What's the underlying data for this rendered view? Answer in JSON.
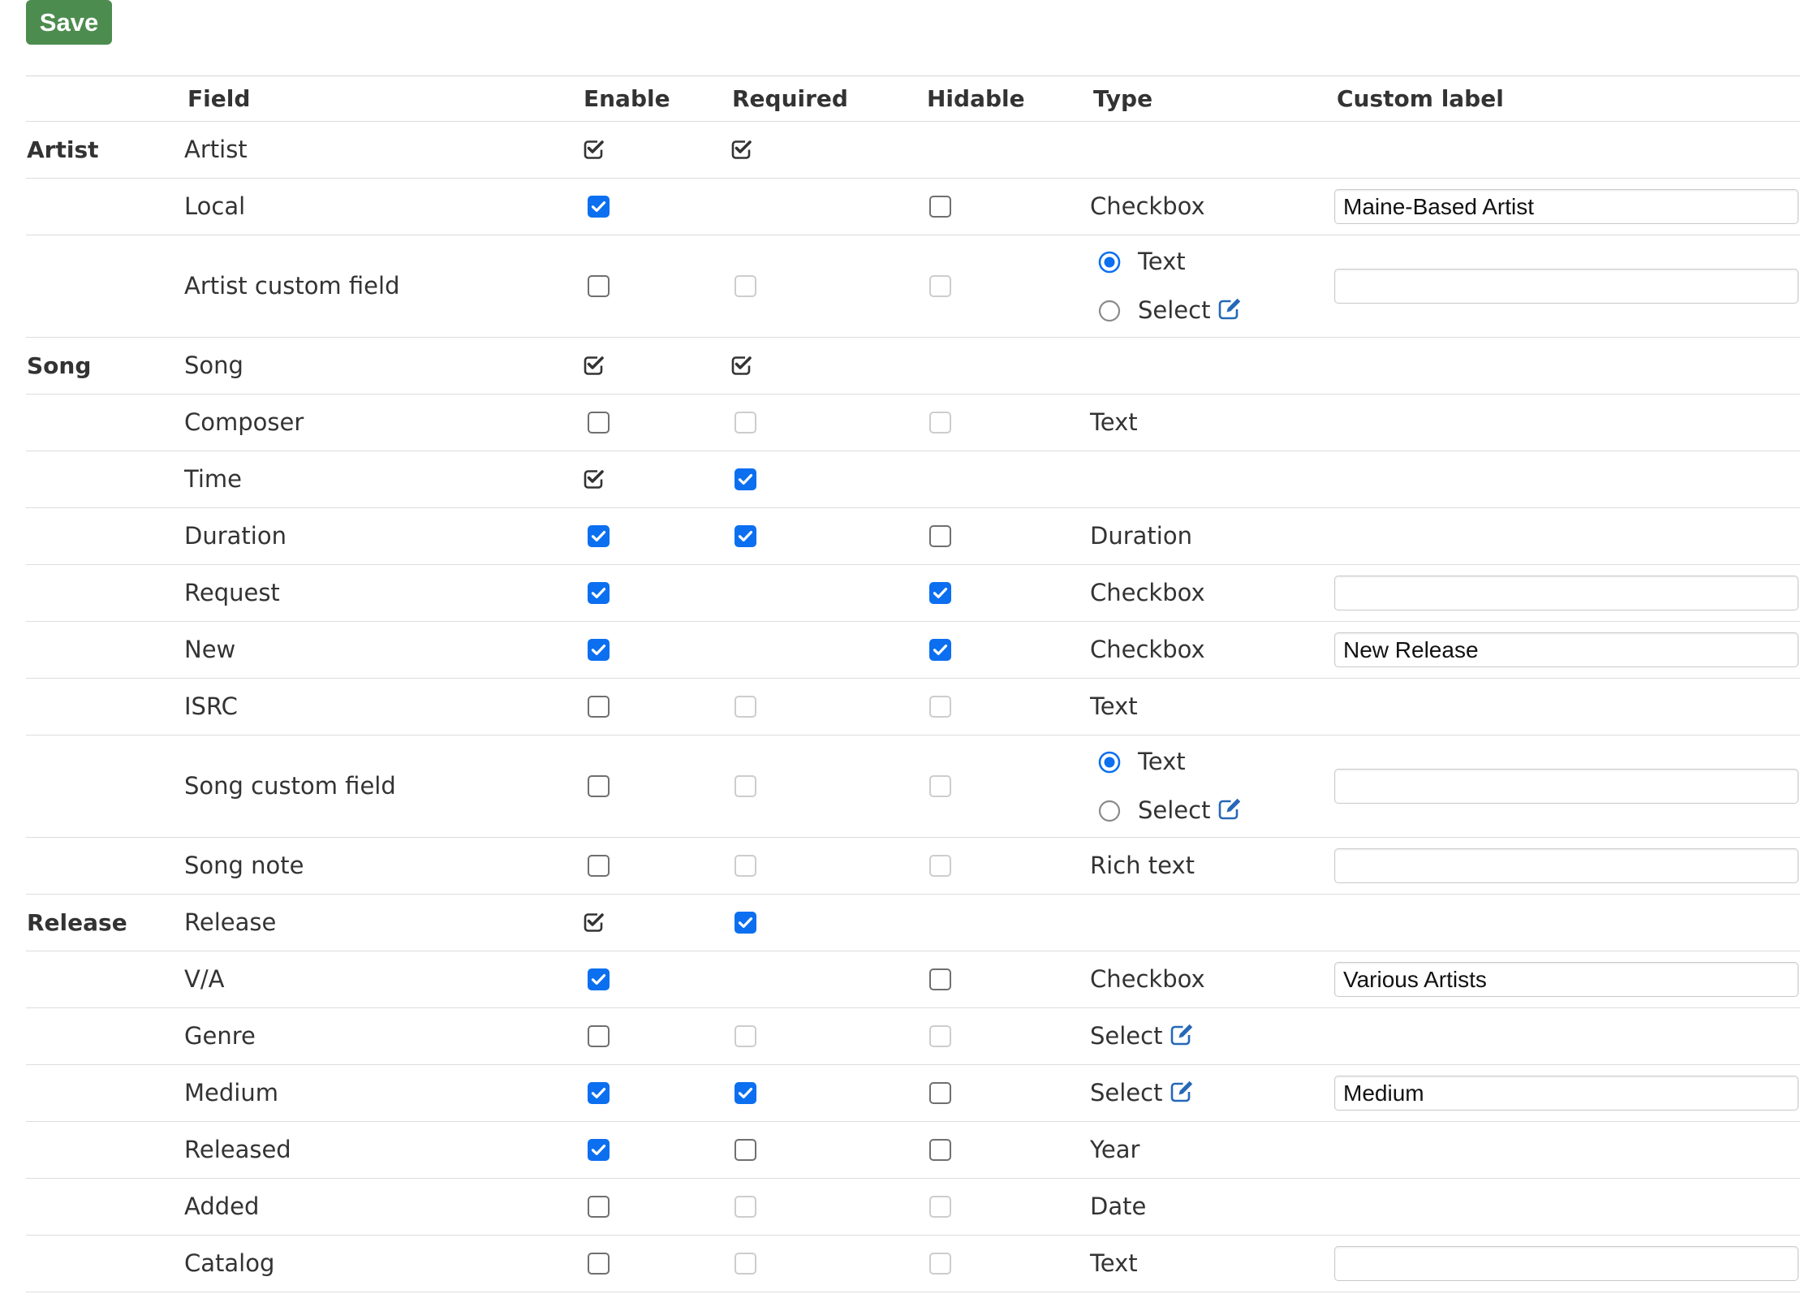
{
  "toolbar": {
    "save_label": "Save"
  },
  "colors": {
    "accent": "#0b6ff0",
    "save_button": "#4d8c4f",
    "edit_icon": "#2568b8",
    "text": "#333333",
    "border": "#dddddd"
  },
  "icons": {
    "readonly_checked": "check-square-icon",
    "edit": "edit-icon"
  },
  "columns": {
    "field": "Field",
    "enable": "Enable",
    "required": "Required",
    "hidable": "Hidable",
    "type": "Type",
    "custom_label": "Custom label"
  },
  "rows": [
    {
      "section": "Artist",
      "field": "Artist",
      "enable": {
        "checked": true,
        "readonly": true
      },
      "required": {
        "checked": true,
        "readonly": true
      },
      "hidable": null,
      "type": null,
      "custom_label": null
    },
    {
      "field": "Local",
      "enable": {
        "checked": true
      },
      "required": null,
      "hidable": {
        "checked": false
      },
      "type": {
        "text": "Checkbox"
      },
      "custom_label": {
        "value": "Maine-Based Artist"
      }
    },
    {
      "field": "Artist custom field",
      "enable": {
        "checked": false
      },
      "required": {
        "checked": false,
        "disabled": true
      },
      "hidable": {
        "checked": false,
        "disabled": true
      },
      "type": {
        "options": [
          {
            "label": "Text",
            "selected": true
          },
          {
            "label": "Select",
            "selected": false,
            "edit": true
          }
        ]
      },
      "custom_label": {
        "value": ""
      }
    },
    {
      "section": "Song",
      "field": "Song",
      "enable": {
        "checked": true,
        "readonly": true
      },
      "required": {
        "checked": true,
        "readonly": true
      },
      "hidable": null,
      "type": null,
      "custom_label": null
    },
    {
      "field": "Composer",
      "enable": {
        "checked": false
      },
      "required": {
        "checked": false,
        "disabled": true
      },
      "hidable": {
        "checked": false,
        "disabled": true
      },
      "type": {
        "text": "Text"
      },
      "custom_label": null
    },
    {
      "field": "Time",
      "enable": {
        "checked": true,
        "readonly": true
      },
      "required": {
        "checked": true
      },
      "hidable": null,
      "type": null,
      "custom_label": null
    },
    {
      "field": "Duration",
      "enable": {
        "checked": true
      },
      "required": {
        "checked": true
      },
      "hidable": {
        "checked": false
      },
      "type": {
        "text": "Duration"
      },
      "custom_label": null
    },
    {
      "field": "Request",
      "enable": {
        "checked": true
      },
      "required": null,
      "hidable": {
        "checked": true
      },
      "type": {
        "text": "Checkbox"
      },
      "custom_label": {
        "value": ""
      }
    },
    {
      "field": "New",
      "enable": {
        "checked": true
      },
      "required": null,
      "hidable": {
        "checked": true
      },
      "type": {
        "text": "Checkbox"
      },
      "custom_label": {
        "value": "New Release"
      }
    },
    {
      "field": "ISRC",
      "enable": {
        "checked": false
      },
      "required": {
        "checked": false,
        "disabled": true
      },
      "hidable": {
        "checked": false,
        "disabled": true
      },
      "type": {
        "text": "Text"
      },
      "custom_label": null
    },
    {
      "field": "Song custom field",
      "enable": {
        "checked": false
      },
      "required": {
        "checked": false,
        "disabled": true
      },
      "hidable": {
        "checked": false,
        "disabled": true
      },
      "type": {
        "options": [
          {
            "label": "Text",
            "selected": true
          },
          {
            "label": "Select",
            "selected": false,
            "edit": true
          }
        ]
      },
      "custom_label": {
        "value": ""
      }
    },
    {
      "field": "Song note",
      "enable": {
        "checked": false
      },
      "required": {
        "checked": false,
        "disabled": true
      },
      "hidable": {
        "checked": false,
        "disabled": true
      },
      "type": {
        "text": "Rich text"
      },
      "custom_label": {
        "value": ""
      }
    },
    {
      "section": "Release",
      "field": "Release",
      "enable": {
        "checked": true,
        "readonly": true
      },
      "required": {
        "checked": true
      },
      "hidable": null,
      "type": null,
      "custom_label": null
    },
    {
      "field": "V/A",
      "enable": {
        "checked": true
      },
      "required": null,
      "hidable": {
        "checked": false
      },
      "type": {
        "text": "Checkbox"
      },
      "custom_label": {
        "value": "Various Artists"
      }
    },
    {
      "field": "Genre",
      "enable": {
        "checked": false
      },
      "required": {
        "checked": false,
        "disabled": true
      },
      "hidable": {
        "checked": false,
        "disabled": true
      },
      "type": {
        "text": "Select",
        "edit": true
      },
      "custom_label": null
    },
    {
      "field": "Medium",
      "enable": {
        "checked": true
      },
      "required": {
        "checked": true
      },
      "hidable": {
        "checked": false
      },
      "type": {
        "text": "Select",
        "edit": true
      },
      "custom_label": {
        "value": "Medium"
      }
    },
    {
      "field": "Released",
      "enable": {
        "checked": true
      },
      "required": {
        "checked": false
      },
      "hidable": {
        "checked": false
      },
      "type": {
        "text": "Year"
      },
      "custom_label": null
    },
    {
      "field": "Added",
      "enable": {
        "checked": false
      },
      "required": {
        "checked": false,
        "disabled": true
      },
      "hidable": {
        "checked": false,
        "disabled": true
      },
      "type": {
        "text": "Date"
      },
      "custom_label": null
    },
    {
      "field": "Catalog",
      "enable": {
        "checked": false
      },
      "required": {
        "checked": false,
        "disabled": true
      },
      "hidable": {
        "checked": false,
        "disabled": true
      },
      "type": {
        "text": "Text"
      },
      "custom_label": {
        "value": ""
      }
    }
  ]
}
